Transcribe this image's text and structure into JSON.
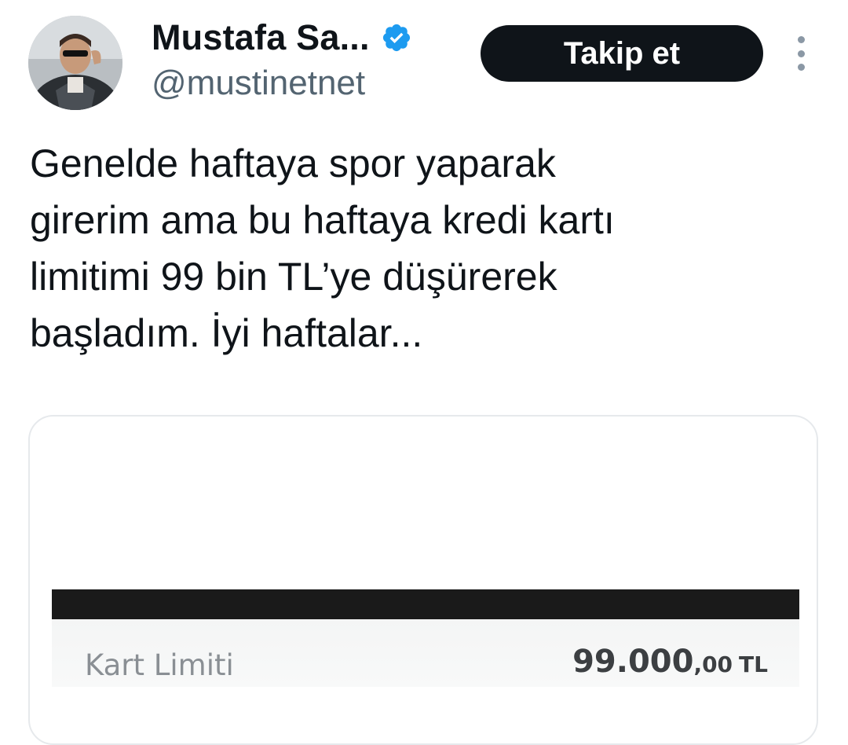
{
  "author": {
    "display_name": "Mustafa Sa...",
    "handle": "@mustinetnet",
    "verified": true,
    "verified_icon": "verified-badge-icon",
    "avatar": "profile-photo"
  },
  "actions": {
    "follow_label": "Takip et",
    "more_icon": "more-options-vertical-icon"
  },
  "tweet": {
    "text_lines": [
      "Genelde haftaya spor yaparak",
      "girerim ama bu haftaya kredi kartı",
      "limitimi 99 bin TL’ye düşürerek",
      "başladım. İyi haftalar..."
    ]
  },
  "media": {
    "row_label": "Kart Limiti",
    "value_main": "99.000",
    "value_decimals": ",00",
    "value_currency": "TL"
  },
  "colors": {
    "verified_blue": "#1d9bf0",
    "follow_button_bg": "#0f1419",
    "handle_gray": "#536471"
  }
}
